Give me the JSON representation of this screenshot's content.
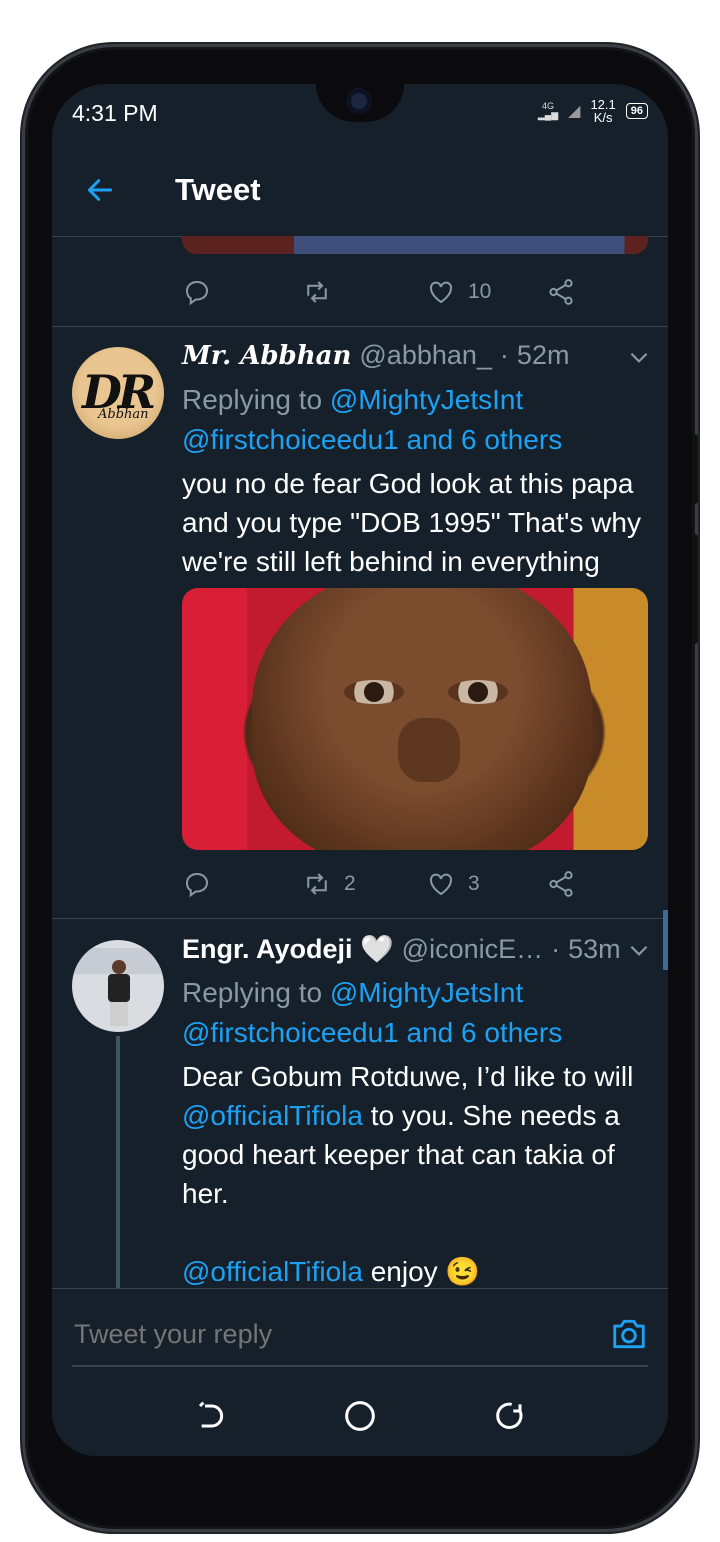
{
  "status": {
    "time": "4:31 PM",
    "network": "4G",
    "speed_value": "12.1",
    "speed_unit": "K/s",
    "battery": "96"
  },
  "header": {
    "title": "Tweet"
  },
  "prev_tweet_actions": {
    "retweets": "",
    "likes": "10"
  },
  "tweet1": {
    "name": "Mr. Abbhan",
    "handle": "@abbhan_",
    "dot": "·",
    "time": "52m",
    "replying_prefix": "Replying to",
    "mention1": "@MightyJetsInt",
    "mention2": "@firstchoiceedu1 and 6 others",
    "text": "you no de fear God look at this papa and you type \"DOB 1995\" That's why we're still left behind in everything",
    "retweets": "2",
    "likes": "3",
    "avatar_text": "DR",
    "avatar_sub": "Abbhan"
  },
  "tweet2": {
    "name": "Engr. Ayodeji 🤍",
    "handle": "@iconicE…",
    "dot": "·",
    "time": "53m",
    "replying_prefix": "Replying to",
    "mention1": "@MightyJetsInt",
    "mention2": "@firstchoiceedu1 and 6 others",
    "text_part1": "Dear Gobum Rotduwe, I’d like to will",
    "text_mention": "@officialTifiola",
    "text_part2": "to you. She needs a good heart keeper that can takia of her.",
    "text2_mention": "@officialTifiola",
    "text2_rest": "enjoy 😉"
  },
  "reply": {
    "placeholder": "Tweet your reply"
  },
  "colors": {
    "background": "#15202b",
    "accent": "#1da1f2",
    "muted": "#8899a6"
  },
  "icons": [
    "back-arrow-icon",
    "reply-icon",
    "retweet-icon",
    "like-icon",
    "share-icon",
    "chevron-down-icon",
    "camera-icon",
    "nav-back-icon",
    "nav-home-icon",
    "nav-recent-icon"
  ]
}
